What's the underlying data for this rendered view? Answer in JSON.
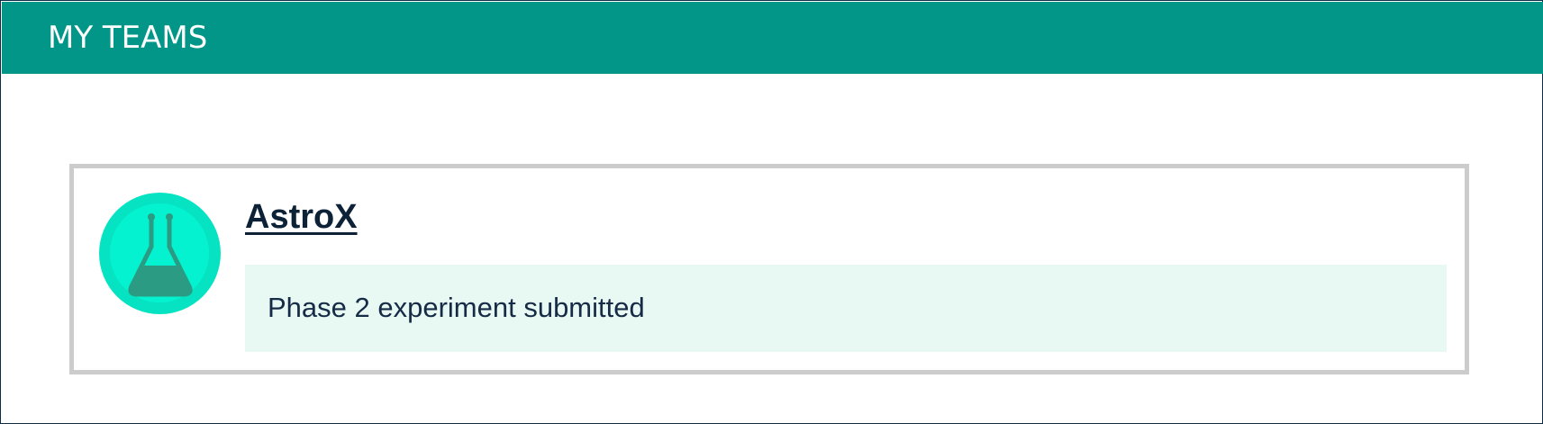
{
  "header": {
    "title": "MY TEAMS"
  },
  "team": {
    "name": "AstroX",
    "status": "Phase 2 experiment submitted",
    "avatar_icon": "flask-icon"
  },
  "colors": {
    "header_bg": "#019688",
    "header_text": "#ffffff",
    "avatar_bg": "#06e3c2",
    "status_bg": "#e8f8f3",
    "text_dark": "#0d2236",
    "card_border": "#cccccc"
  }
}
